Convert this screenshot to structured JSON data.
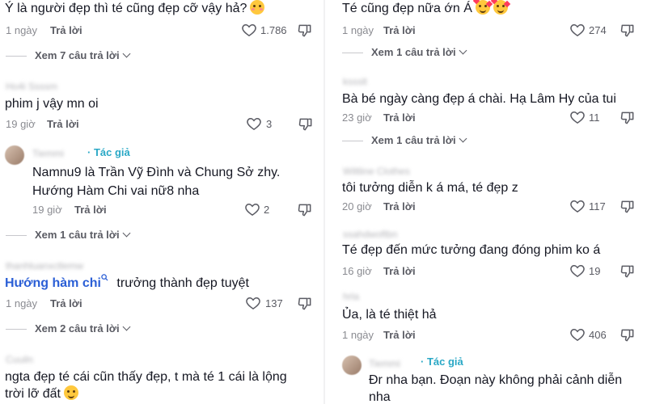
{
  "left": {
    "c1": {
      "text": "Ý là người đẹp thì té cũng đẹp cỡ vậy hả?",
      "time": "1 ngày",
      "reply": "Trả lời",
      "likes": "1.786",
      "view_more": "Xem 7 câu trả lời",
      "emoji": "flushed-face-emoji"
    },
    "c2": {
      "username": "Ho4i Ssssm",
      "text": "phim j vậy mn oi",
      "time": "19 giờ",
      "reply": "Trả lời",
      "likes": "3"
    },
    "c3": {
      "username": "Tiemmi",
      "author_badge": "· Tác giả",
      "text_line1": "Namnu9 là Trần Vỹ Đình và Chung Sở zhy.",
      "text_line2": "Hướng Hàm Chi vai nữ8 nha",
      "time": "19 giờ",
      "reply": "Trả lời",
      "likes": "2",
      "view_more": "Xem 1 câu trả lời"
    },
    "c4": {
      "username": "thanhluanxctlemw",
      "search_link": "Hướng hàm chi",
      "text": " trưởng thành đẹp tuyệt",
      "time": "1 ngày",
      "reply": "Trả lời",
      "likes": "137",
      "view_more": "Xem 2 câu trả lời"
    },
    "c5": {
      "username": "Cuuiln",
      "text_line1": "ngta đẹp té cái cũn thấy đẹp, t mà té 1 cái là lộng",
      "text_line2": "trời lỡ đất",
      "emoji": "smiling-face-emoji"
    }
  },
  "right": {
    "c1": {
      "text": "Té cũng đẹp nữa ớn Á",
      "time": "1 ngày",
      "reply": "Trả lời",
      "likes": "274",
      "view_more": "Xem 1 câu trả lời",
      "emoji": "smiling-hearts-emoji"
    },
    "c2": {
      "username": "kssslt",
      "text": "Bà bé ngày càng đẹp á chài. Hạ Lâm Hy của tui",
      "time": "23 giờ",
      "reply": "Trả lời",
      "likes": "11",
      "view_more": "Xem 1 câu trả lời"
    },
    "c3": {
      "username": "Wiltline Clothes",
      "text": "tôi tưởng diễn k á má, té đẹp z",
      "time": "20 giờ",
      "reply": "Trả lời",
      "likes": "117"
    },
    "c4": {
      "username": "ssahdwoftbn",
      "text": "Té đẹp đến mức tưởng đang đóng phim ko á",
      "time": "16 giờ",
      "reply": "Trả lời",
      "likes": "19"
    },
    "c5": {
      "username": "hrla",
      "text": "Ủa, là té thiệt hả",
      "time": "1 ngày",
      "reply": "Trả lời",
      "likes": "406"
    },
    "c6": {
      "username": "Tiemmi",
      "author_badge": "· Tác giả",
      "text_line1": "Đr nha bạn. Đoạn này không phải cảnh diễn",
      "text_line2": "nha"
    }
  }
}
